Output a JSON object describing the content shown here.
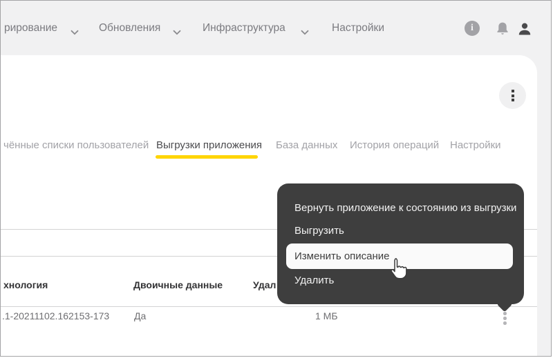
{
  "topnav": {
    "items": [
      {
        "label": "рирование",
        "has_chevron": true
      },
      {
        "label": "Обновления",
        "has_chevron": true
      },
      {
        "label": "Инфраструктура",
        "has_chevron": true
      },
      {
        "label": "Настройки",
        "has_chevron": false
      }
    ],
    "info_glyph": "i"
  },
  "tabs": [
    {
      "label": "чённые списки пользователей",
      "active": false
    },
    {
      "label": "Выгрузки приложения",
      "active": true
    },
    {
      "label": "База данных",
      "active": false
    },
    {
      "label": "История операций",
      "active": false
    },
    {
      "label": "Настройки",
      "active": false
    }
  ],
  "table": {
    "headers": [
      "хнология",
      "Двоичные данные",
      "Удал"
    ],
    "row": {
      "version": ".1-20211102.162153-173",
      "binary_data": "Да",
      "size": "1 МБ"
    }
  },
  "context_menu": {
    "items": [
      {
        "label": "Вернуть приложение к состоянию из выгрузки",
        "highlighted": false
      },
      {
        "label": "Выгрузить",
        "highlighted": false
      },
      {
        "label": "Изменить описание",
        "highlighted": true
      },
      {
        "label": "Удалить",
        "highlighted": false
      }
    ]
  },
  "colors": {
    "accent_yellow": "#ffd500",
    "menu_bg": "#3e3e3e",
    "topbar_bg": "#f1f1f2",
    "panel_bg": "#ffffff",
    "inactive_text": "#a2a2a7",
    "active_text": "#4b4b4e"
  }
}
